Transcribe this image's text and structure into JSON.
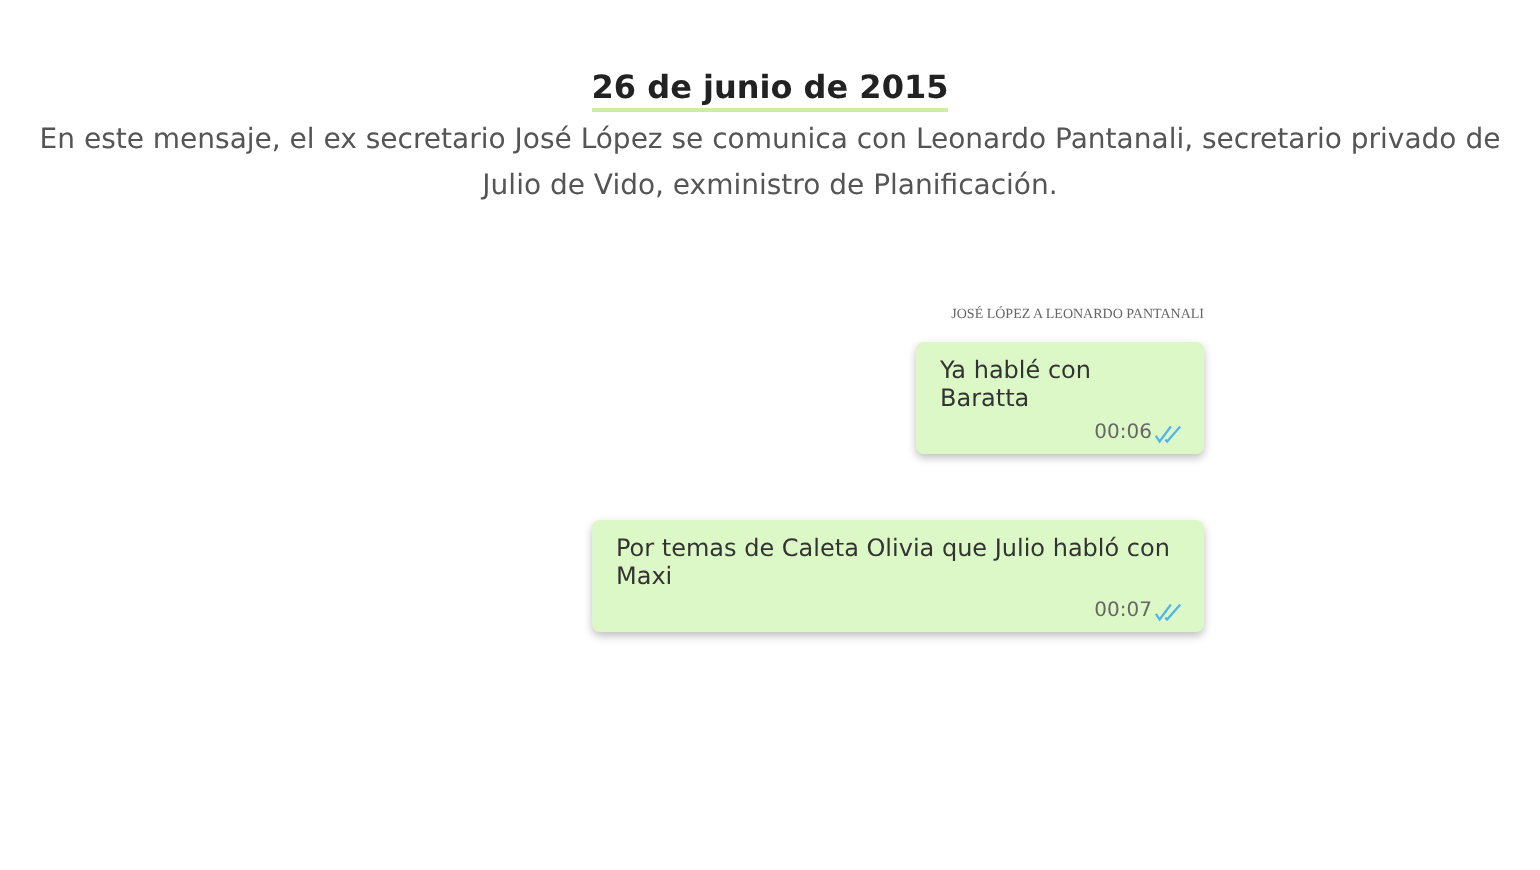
{
  "heading": "26 de junio de 2015",
  "description": "En este mensaje, el ex secretario José López se comunica con Leonardo Pantanali, secretario privado de Julio de Vido, exministro de Planificación.",
  "chat": {
    "label": "JOSÉ LÓPEZ A LEONARDO PANTANALI",
    "messages": [
      {
        "text": "Ya hablé con Baratta",
        "time": "00:06",
        "read": true
      },
      {
        "text": "Por temas de Caleta Olivia que Julio habló con Maxi",
        "time": "00:07",
        "read": true
      }
    ]
  }
}
